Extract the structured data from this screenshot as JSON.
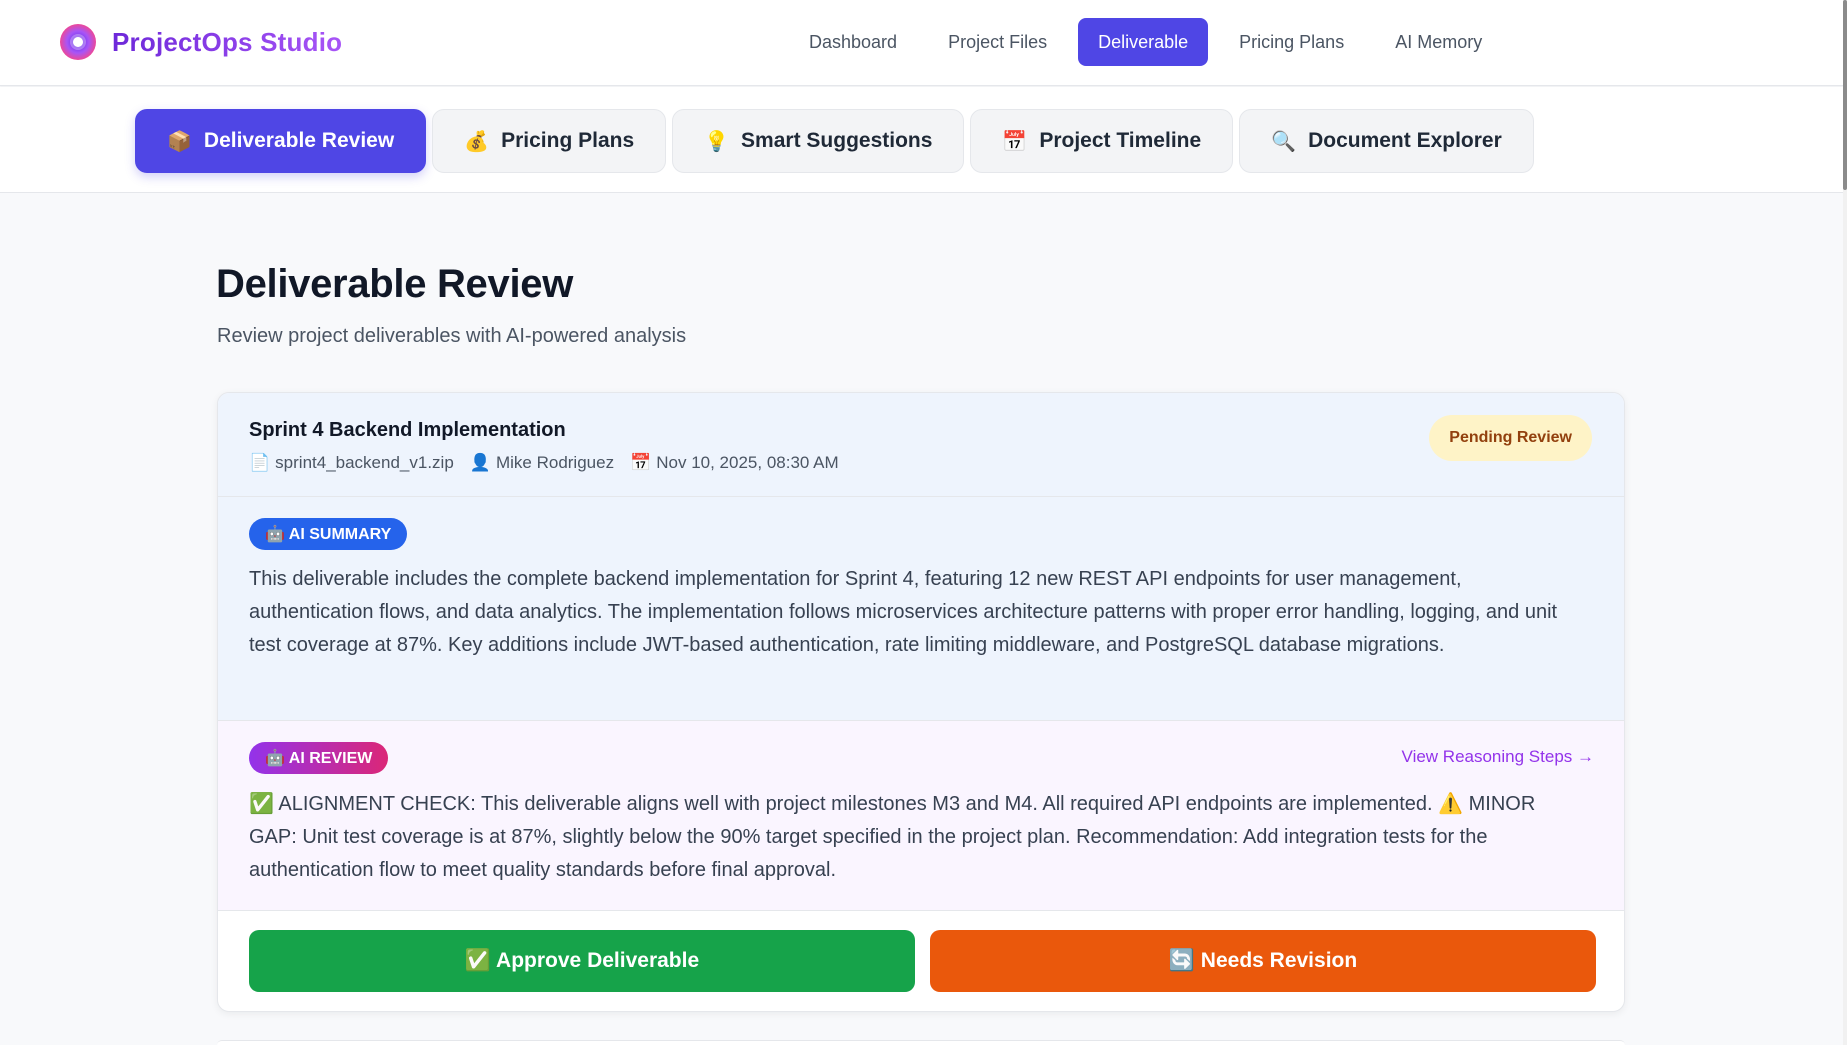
{
  "brand": {
    "name": "ProjectOps Studio",
    "logo_icon": "sparkle-logo-icon"
  },
  "nav": [
    {
      "label": "Dashboard",
      "active": false
    },
    {
      "label": "Project Files",
      "active": false
    },
    {
      "label": "Deliverable",
      "active": true
    },
    {
      "label": "Pricing Plans",
      "active": false
    },
    {
      "label": "AI Memory",
      "active": false
    }
  ],
  "subtabs": [
    {
      "glyph": "📦",
      "label": "Deliverable Review",
      "active": true
    },
    {
      "glyph": "💰",
      "label": "Pricing Plans",
      "active": false
    },
    {
      "glyph": "💡",
      "label": "Smart Suggestions",
      "active": false
    },
    {
      "glyph": "📅",
      "label": "Project Timeline",
      "active": false
    },
    {
      "glyph": "🔍",
      "label": "Document Explorer",
      "active": false
    }
  ],
  "page": {
    "title": "Deliverable Review",
    "subtitle": "Review project deliverables with AI-powered analysis"
  },
  "deliverable": {
    "title": "Sprint 4 Backend Implementation",
    "file_glyph": "📄",
    "file": "sprint4_backend_v1.zip",
    "user_glyph": "👤",
    "author": "Mike Rodriguez",
    "date_glyph": "📅",
    "date": "Nov 10, 2025, 08:30 AM",
    "status": "Pending Review",
    "summary_badge": "🤖 AI SUMMARY",
    "summary": "This deliverable includes the complete backend implementation for Sprint 4, featuring 12 new REST API endpoints for user management, authentication flows, and data analytics. The implementation follows microservices architecture patterns with proper error handling, logging, and unit test coverage at 87%. Key additions include JWT-based authentication, rate limiting middleware, and PostgreSQL database migrations.",
    "review_badge": "🤖 AI REVIEW",
    "reasoning_link": "View Reasoning Steps →",
    "review": "✅ ALIGNMENT CHECK: This deliverable aligns well with project milestones M3 and M4. All required API endpoints are implemented. ⚠️ MINOR GAP: Unit test coverage is at 87%, slightly below the 90% target specified in the project plan. Recommendation: Add integration tests for the authentication flow to meet quality standards before final approval.",
    "approve_label": "✅ Approve Deliverable",
    "revise_label": "🔄 Needs Revision"
  },
  "colors": {
    "accent": "#4f46e5",
    "approve": "#16a34a",
    "revise": "#ea580c",
    "pending_bg": "#fef3c7",
    "pending_text": "#92400e"
  }
}
